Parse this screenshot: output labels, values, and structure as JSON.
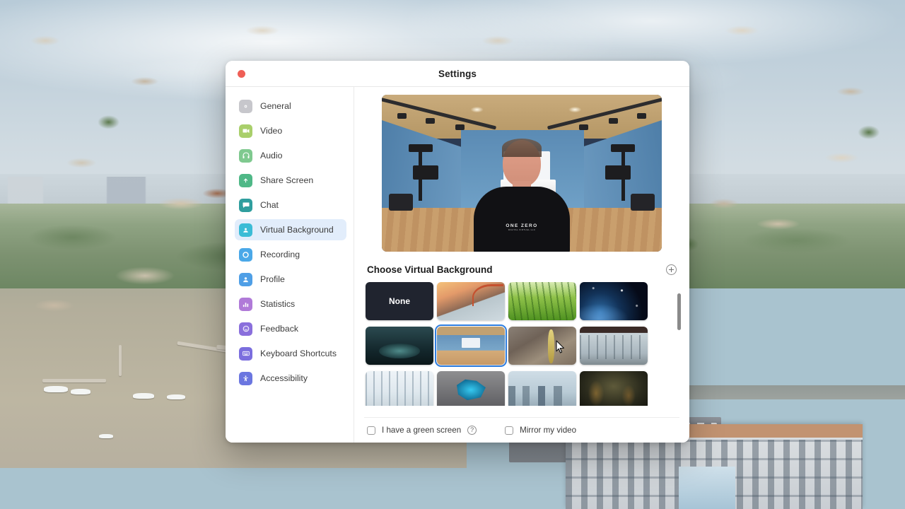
{
  "window": {
    "title": "Settings",
    "close_button": "close"
  },
  "sidebar": {
    "items": [
      {
        "label": "General",
        "icon": "gear-icon",
        "color": "#c7c7cc",
        "active": false
      },
      {
        "label": "Video",
        "icon": "camera-icon",
        "color": "#a9cf6b",
        "active": false
      },
      {
        "label": "Audio",
        "icon": "headphones-icon",
        "color": "#7fc98f",
        "active": false
      },
      {
        "label": "Share Screen",
        "icon": "upload-icon",
        "color": "#4fb887",
        "active": false
      },
      {
        "label": "Chat",
        "icon": "chat-icon",
        "color": "#2f9e9e",
        "active": false
      },
      {
        "label": "Virtual Background",
        "icon": "person-card-icon",
        "color": "#3bbcd6",
        "active": true
      },
      {
        "label": "Recording",
        "icon": "record-icon",
        "color": "#4aa8e8",
        "active": false
      },
      {
        "label": "Profile",
        "icon": "person-icon",
        "color": "#4f9fe6",
        "active": false
      },
      {
        "label": "Statistics",
        "icon": "bar-chart-icon",
        "color": "#b07ad8",
        "active": false
      },
      {
        "label": "Feedback",
        "icon": "smiley-icon",
        "color": "#8a6fdc",
        "active": false
      },
      {
        "label": "Keyboard Shortcuts",
        "icon": "keyboard-icon",
        "color": "#7b6ede",
        "active": false
      },
      {
        "label": "Accessibility",
        "icon": "accessibility-icon",
        "color": "#6b76e0",
        "active": false
      }
    ]
  },
  "main": {
    "preview": {
      "name": "video-preview",
      "shirt_logo": "ONE ZERO",
      "shirt_logo_sub": "DIGITAL VIRTUAL LLC"
    },
    "section_title": "Choose Virtual Background",
    "add_button_label": "+",
    "backgrounds": [
      {
        "label": "None",
        "art": "none",
        "selected": false
      },
      {
        "label": "",
        "art": "bgGG",
        "selected": false
      },
      {
        "label": "",
        "art": "bgGrass",
        "selected": false
      },
      {
        "label": "",
        "art": "bgSpace",
        "selected": false
      },
      {
        "label": "",
        "art": "bgSci",
        "selected": false
      },
      {
        "label": "",
        "art": "bgStudio",
        "selected": true
      },
      {
        "label": "",
        "art": "bgCanyon",
        "selected": false
      },
      {
        "label": "",
        "art": "bgBalcony",
        "selected": false
      },
      {
        "label": "",
        "art": "bgOffice",
        "selected": false
      },
      {
        "label": "",
        "art": "bgIce",
        "selected": false
      },
      {
        "label": "",
        "art": "bgNYC",
        "selected": false
      },
      {
        "label": "",
        "art": "bgForest",
        "selected": false
      },
      {
        "label": "",
        "art": "bgP1",
        "selected": false
      },
      {
        "label": "",
        "art": "bgP2",
        "selected": false
      },
      {
        "label": "",
        "art": "bgP3",
        "selected": false
      },
      {
        "label": "",
        "art": "bgP4",
        "selected": false
      }
    ],
    "footer": {
      "green_screen_label": "I have a green screen",
      "green_screen_checked": false,
      "help_glyph": "?",
      "mirror_label": "Mirror my video",
      "mirror_checked": false
    }
  },
  "colors": {
    "accent": "#2f7ee0",
    "active_nav_bg": "#e2edfb",
    "close_button": "#ef5f56"
  }
}
